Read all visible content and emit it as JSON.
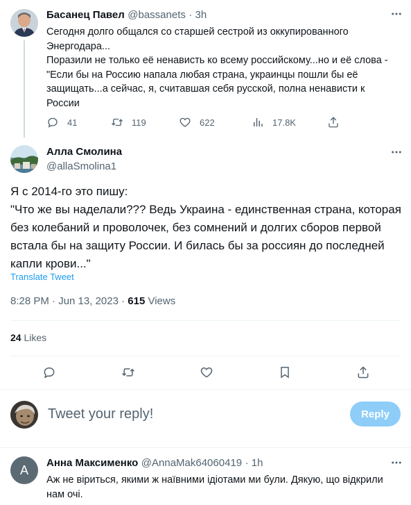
{
  "parent_tweet": {
    "name": "Басанец Павел",
    "handle": "@bassanets",
    "time": "· 3h",
    "lines": [
      "Сегодня долго общался со старшей сестрой из оккупированного",
      "Энергодара...",
      "Поразили не только её ненависть ко всему российскому...но и её слова -",
      "\"Если бы на Россию напала любая страна, украинцы пошли бы её",
      "защищать...а сейчас, я, считавшая себя русской, полна ненависти к",
      "России"
    ],
    "replies": "41",
    "retweets": "119",
    "likes": "622",
    "views": "17.8K"
  },
  "main_tweet": {
    "name": "Алла Смолина",
    "handle": "@allaSmolina1",
    "lines": [
      "Я с 2014-го это пишу:",
      "\"Что же вы наделали??? Ведь Украина - единственная страна, которая",
      "без колебаний и проволочек, без сомнений и долгих сборов первой",
      "встала бы на защиту России. И билась бы за россиян до последней",
      "капли крови...\""
    ],
    "translate": "Translate Tweet",
    "timestamp": "8:28 PM · Jun 13, 2023 · ",
    "views_count": "615",
    "views_label": " Views",
    "likes_count": "24",
    "likes_label": " Likes"
  },
  "reply_box": {
    "placeholder": "Tweet your reply!",
    "button": "Reply"
  },
  "reply_tweet": {
    "avatar_letter": "A",
    "name": "Анна Максименко",
    "handle": "@AnnaMak64060419",
    "time": "· 1h",
    "lines": [
      "Аж не віриться, якими ж наївними ідіотами ми були. Дякую, що відкрили",
      "нам очі."
    ]
  },
  "colors": {
    "accent": "#1d9bf0",
    "muted": "#536471",
    "reply_button": "#8ecdf8",
    "reply_avatar": "#5c6b73"
  },
  "icons": [
    "reply-icon",
    "retweet-icon",
    "like-icon",
    "views-icon",
    "share-icon",
    "bookmark-icon",
    "more-icon"
  ]
}
